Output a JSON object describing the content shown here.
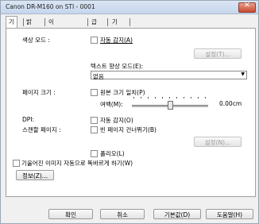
{
  "window": {
    "title": "Canon DR-M160 on STI - 0001"
  },
  "tabs": [
    {
      "label": "기본"
    },
    {
      "label": "밝기"
    },
    {
      "label": "이미지 처리"
    },
    {
      "label": "급지"
    },
    {
      "label": "기타"
    }
  ],
  "color_mode": {
    "label": "색상 모드 :",
    "auto_detect": "자동 감지(A)",
    "settings_button": "설정(T)...",
    "text_enhance_label": "텍스트 향상 모드(E):",
    "text_enhance_value": "없음"
  },
  "page_size": {
    "label": "페이지 크기 :",
    "match_original": "원본 크기 일치(P)",
    "margin_label": "여백(M):",
    "margin_value": "0.00cm"
  },
  "dpi": {
    "label": "DPI:",
    "auto_detect": "자동 감지(O)"
  },
  "scan_side": {
    "label": "스캔할 페이지 :",
    "skip_blank": "빈 페이지 건너뛰기(B)",
    "settings_button": "설정(N)..."
  },
  "folio": {
    "label": "폴리오(L)"
  },
  "deskew": {
    "label": "기울어진 이미지 자동으로 똑바르게 하기(W)"
  },
  "info_button": "정보(Z)...",
  "footer": {
    "ok": "확인",
    "cancel": "취소",
    "defaults": "기본값(D)",
    "help": "도움말(H)"
  }
}
